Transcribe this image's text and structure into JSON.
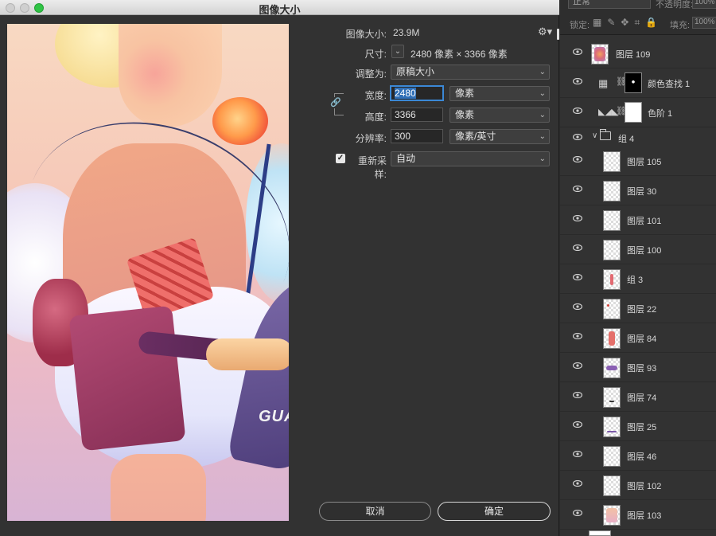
{
  "dialog": {
    "title": "图像大小",
    "image_size_label": "图像大小:",
    "image_size_value": "23.9M",
    "dimensions_label": "尺寸:",
    "dimensions_value": "2480 像素  ×  3366 像素",
    "fit_to_label": "调整为:",
    "fit_to_value": "原稿大小",
    "width_label": "宽度:",
    "width_value": "2480",
    "width_unit": "像素",
    "height_label": "高度:",
    "height_value": "3366",
    "height_unit": "像素",
    "resolution_label": "分辨率:",
    "resolution_value": "300",
    "resolution_unit": "像素/英寸",
    "resample_label": "重新采样:",
    "resample_checked": true,
    "resample_value": "自动",
    "cancel_label": "取消",
    "ok_label": "确定",
    "preview_text": "GUA"
  },
  "panel": {
    "blend_mode": "正常",
    "opacity_label": "不透明度:",
    "opacity_value": "100%",
    "lock_label": "锁定:",
    "fill_label": "填充:",
    "fill_value": "100%",
    "layers": [
      {
        "name": "图层 109",
        "kind": "top"
      },
      {
        "name": "颜色查找 1",
        "kind": "lookup"
      },
      {
        "name": "色阶 1",
        "kind": "levels"
      },
      {
        "name": "组 4",
        "kind": "group"
      },
      {
        "name": "图层 105"
      },
      {
        "name": "图层 30"
      },
      {
        "name": "图层 101"
      },
      {
        "name": "图层 100"
      },
      {
        "name": "组 3"
      },
      {
        "name": "图层 22"
      },
      {
        "name": "图层 84"
      },
      {
        "name": "图层 93"
      },
      {
        "name": "图层 74"
      },
      {
        "name": "图层 25"
      },
      {
        "name": "图层 46"
      },
      {
        "name": "图层 102"
      },
      {
        "name": "图层 103"
      }
    ]
  },
  "colors": {
    "accent_focus": "#3b88d6",
    "window_green": "#2fc445",
    "panel_bg": "#323232"
  }
}
